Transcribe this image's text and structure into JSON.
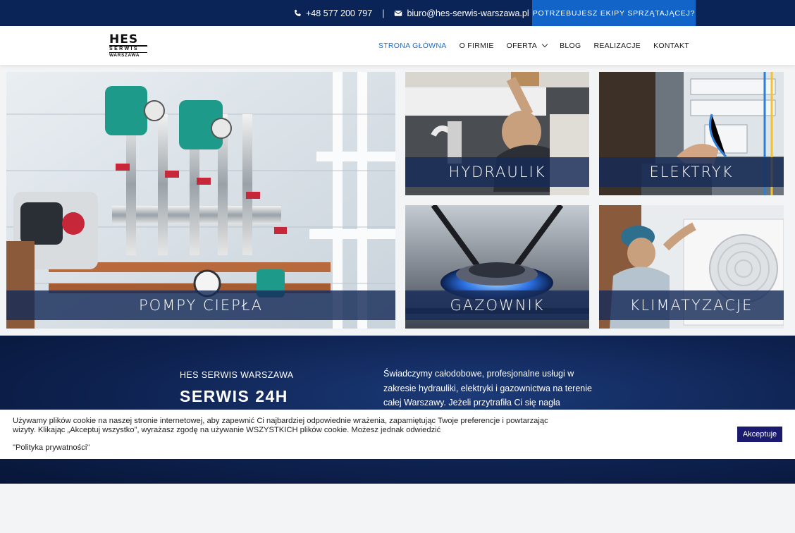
{
  "topbar": {
    "phone": "+48 577 200 797",
    "separator": "|",
    "email": "biuro@hes-serwis-warszawa.pl",
    "cta_label": "POTRZEBUJESZ EKIPY SPRZĄTAJĄCEJ?"
  },
  "header": {
    "logo": {
      "line1": "HES",
      "line2": "SERWIS",
      "line3": "WARSZAWA"
    },
    "nav": [
      {
        "label": "STRONA GŁÓWNA",
        "active": true
      },
      {
        "label": "O FIRMIE"
      },
      {
        "label": "OFERTA",
        "dropdown": true
      },
      {
        "label": "BLOG"
      },
      {
        "label": "REALIZACJE"
      },
      {
        "label": "KONTAKT"
      }
    ]
  },
  "tiles": [
    {
      "label": "POMPY CIEPŁA"
    },
    {
      "label": "HYDRAULIK"
    },
    {
      "label": "ELEKTRYK"
    },
    {
      "label": "GAZOWNIK"
    },
    {
      "label": "KLIMATYZACJE"
    }
  ],
  "info": {
    "subtitle": "HES SERWIS WARSZAWA",
    "title": "SERWIS 24H",
    "text": "Świadczymy całodobowe, profesjonalne usługi w zakresie hydrauliki, elektryki i gazownictwa na terenie całej Warszawy. Jeżeli przytrafiła Ci się nagła"
  },
  "cookie": {
    "message": "Używamy plików cookie na naszej stronie internetowej, aby zapewnić Ci najbardziej odpowiednie wrażenia, zapamiętując Twoje preferencje i powtarzając wizyty. Klikając „Akceptuj wszystko”, wyrażasz zgodę na używanie WSZYSTKICH plików cookie. Możesz jednak odwiedzić",
    "policy": "\"Polityka prywatności\"",
    "accept_label": "Akceptuje"
  },
  "colors": {
    "topbar": "#0b2457",
    "cta": "#1264c9",
    "nav_active": "#1a6fd0",
    "tile_label_bg": "#162b58",
    "accept_button": "#1a1a6e"
  }
}
